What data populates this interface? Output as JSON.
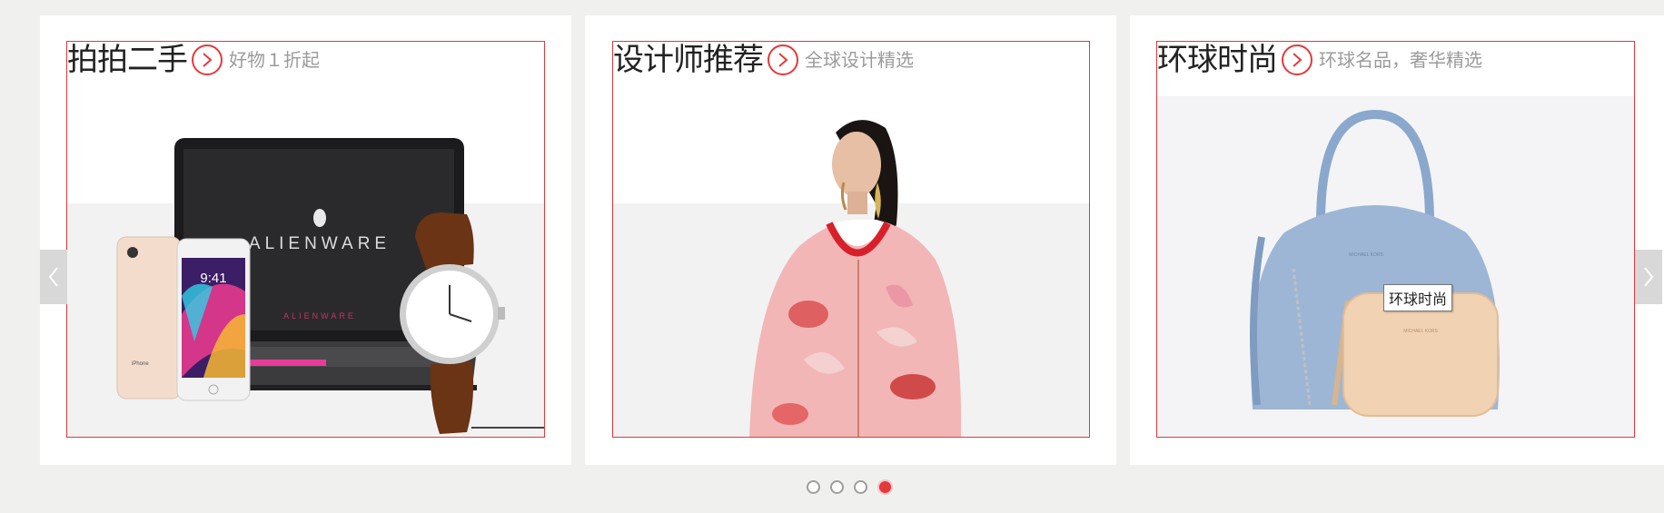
{
  "cards": [
    {
      "title": "拍拍二手",
      "subtitle": "好物１折起"
    },
    {
      "title": "设计师推荐",
      "subtitle": "全球设计精选"
    },
    {
      "title": "环球时尚",
      "subtitle": "环球名品，奢华精选"
    }
  ],
  "products": {
    "laptop_brand": "ALIENWARE",
    "laptop_small_brand": "ALIENWARE",
    "phone_time": "9:41",
    "phone_label": "iPhone"
  },
  "tooltip": "环球时尚",
  "carousel": {
    "page_count": 4,
    "active_index": 3
  },
  "colors": {
    "accent": "#e3393c",
    "background": "#f0f1ef",
    "subtitle": "#9b9b9b"
  },
  "icons": {
    "arrow": "chevron-right-icon",
    "prev": "chevron-left-icon",
    "next": "chevron-right-icon"
  }
}
